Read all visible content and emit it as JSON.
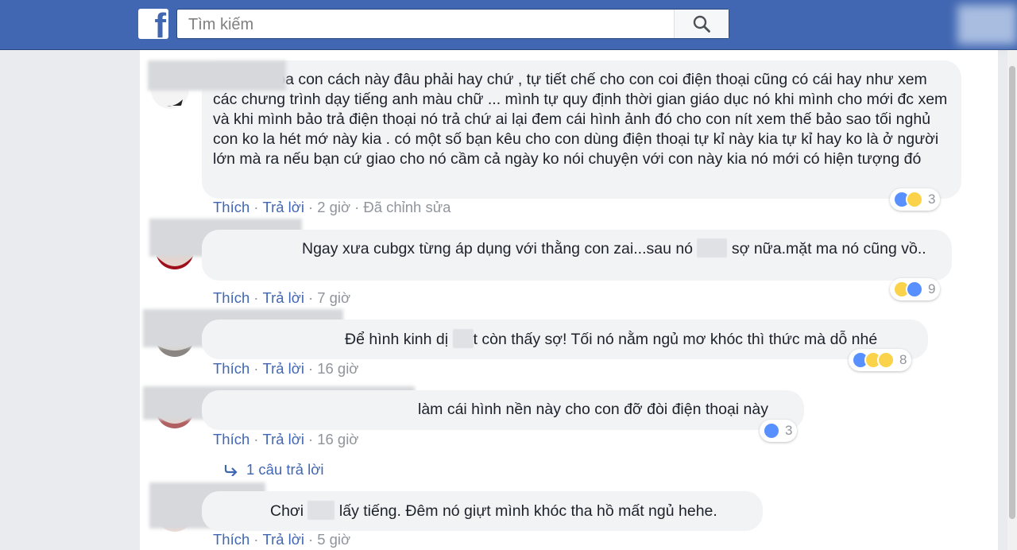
{
  "header": {
    "logo_letter": "f",
    "search_placeholder": "Tìm kiếm"
  },
  "comments": [
    {
      "text": "nói thật dọa con cách này đâu phải hay chứ , tự tiết chế cho con coi điện thoại cũng có cái hay như xem các chưng trình dạy tiếng anh màu chữ ... mình tự quy định thời gian giáo dục nó khi mình cho mới đc xem và khi mình bảo trả điện thoại nó trả chứ ai lại đem cái hình ảnh đó cho con nít xem thế bảo sao tối nghủ con ko la hét mớ này kia . có một số bạn kêu cho con dùng điện thoại tự kỉ này kia tự kỉ hay ko là ở người lớn mà ra nếu bạn cứ giao cho nó cầm cả ngày ko nói chuyện với con này kia nó mới có hiện tượng đó",
      "like": "Thích",
      "reply": "Trả lời",
      "time": "2 giờ",
      "edited": "Đã chỉnh sửa",
      "reaction_count": "3",
      "reactions": [
        "like-icon",
        "sad-icon"
      ]
    },
    {
      "text_a": "Ngay xưa cubgx từng áp dụng với thằng con zai...sau nó ",
      "text_b": "sợ nữa.mặt ma nó cũng vồ..",
      "like": "Thích",
      "reply": "Trả lời",
      "time": "7 giờ",
      "reaction_count": "9",
      "reactions": [
        "haha-icon",
        "like-icon"
      ]
    },
    {
      "text_a": "Để hình kinh dị ",
      "text_b": "t còn thấy sợ! Tối nó nằm ngủ mơ khóc thì thức mà dỗ nhé",
      "like": "Thích",
      "reply": "Trả lời",
      "time": "16 giờ",
      "reaction_count": "8",
      "reactions": [
        "like-icon",
        "haha-icon",
        "wow-icon"
      ]
    },
    {
      "text": "làm cái hình nền này cho con đỡ đòi điện thoại này",
      "like": "Thích",
      "reply": "Trả lời",
      "time": "16 giờ",
      "reaction_count": "3",
      "reactions": [
        "like-icon"
      ],
      "replies_link": "1 câu trả lời"
    },
    {
      "text_a": "Chơi ",
      "text_b": "lấy tiếng. Đêm nó giựt mình khóc tha hồ mất ngủ hehe.",
      "like": "Thích",
      "reply": "Trả lời",
      "time": "5 giờ"
    }
  ],
  "colors": {
    "topbar": "#4267b2",
    "link": "#4267b2",
    "bubble": "#f2f3f5",
    "meta": "#90949c"
  }
}
